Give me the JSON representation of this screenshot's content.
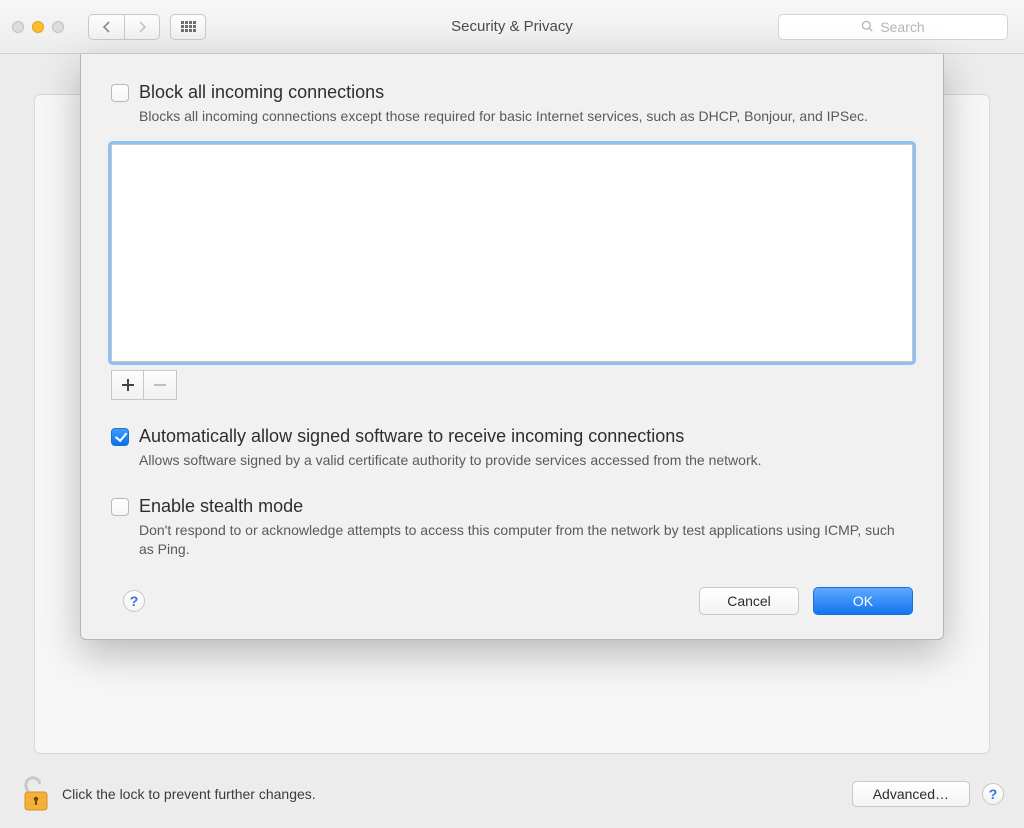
{
  "window": {
    "title": "Security & Privacy",
    "search_placeholder": "Search"
  },
  "sheet": {
    "block_all": {
      "checked": false,
      "label": "Block all incoming connections",
      "description": "Blocks all incoming connections except those required for basic Internet services,  such as DHCP, Bonjour, and IPSec."
    },
    "apps_list": [],
    "add_remove": {
      "add_enabled": true,
      "remove_enabled": false
    },
    "auto_allow": {
      "checked": true,
      "label": "Automatically allow signed software to receive incoming connections",
      "description": "Allows software signed by a valid certificate authority to provide services accessed from the network."
    },
    "stealth": {
      "checked": false,
      "label": "Enable stealth mode",
      "description": "Don't respond to or acknowledge attempts to access this computer from the network by test applications using ICMP, such as Ping."
    },
    "buttons": {
      "cancel": "Cancel",
      "ok": "OK"
    }
  },
  "footer": {
    "lock_text": "Click the lock to prevent further changes.",
    "advanced": "Advanced…"
  }
}
